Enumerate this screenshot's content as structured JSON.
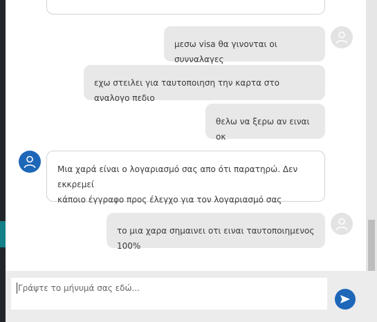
{
  "messages": [
    {
      "role": "agent",
      "text": ""
    },
    {
      "role": "user",
      "text": "μεσω visa θα γινονται οι συνναλαγες"
    },
    {
      "role": "user",
      "text": "εχω στειλει για ταυτοποιηση την καρτα στο αναλογο πεδιο"
    },
    {
      "role": "user",
      "text": "θελω να ξερω αν ειναι οκ"
    },
    {
      "role": "agent",
      "lines": [
        "Μια χαρά είναι ο λογαριασμό σας απο ότι παρατηρώ. Δεν εκκρεμεί",
        "κάποιο έγγραφο προς έλεγχο για τον λογαριασμό σας"
      ]
    },
    {
      "role": "user",
      "text": "το μια χαρα σημαινει οτι ειναι ταυτοποιημενος 100%"
    }
  ],
  "composer": {
    "placeholder": "Γράψτε το μήνυμά σας εδώ...",
    "value": ""
  },
  "icons": {
    "user_avatar": "user-icon",
    "agent_avatar": "user-icon",
    "send": "send-arrow-icon"
  },
  "colors": {
    "accent": "#1e67b8",
    "user_bubble": "#e8e8e8",
    "agent_bubble_border": "#d3d3d3"
  }
}
